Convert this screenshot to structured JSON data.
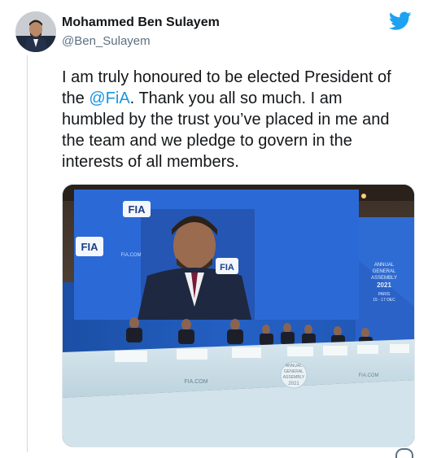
{
  "tweet": {
    "author": {
      "display_name": "Mohammed Ben Sulayem",
      "handle": "@Ben_Sulayem"
    },
    "text_lines": [
      "I am truly honoured to be elected President of",
      "Thank you all so much. I am",
      "humbled by the trust you’ve placed in me and",
      "the team and we pledge to govern in the",
      "interests of all members."
    ],
    "text_prefix_line2": "the ",
    "mention": "@FiA",
    "mention_suffix": ". ",
    "platform_icon": "twitter-bird-icon",
    "accent_color": "#1da1f2"
  },
  "photo": {
    "screen_logo": "FIA",
    "screen_url": "FIA.COM",
    "backdrop_text": [
      "ANNUAL",
      "GENERAL",
      "ASSEMBLY",
      "2021",
      "PARIS",
      "15 - 17 DEC"
    ],
    "desk_text": "FIA.COM",
    "desk_text_right": "FIA.COM",
    "podium_text": [
      "ANNUAL",
      "GENERAL",
      "ASSEMBLY",
      "2021"
    ]
  }
}
